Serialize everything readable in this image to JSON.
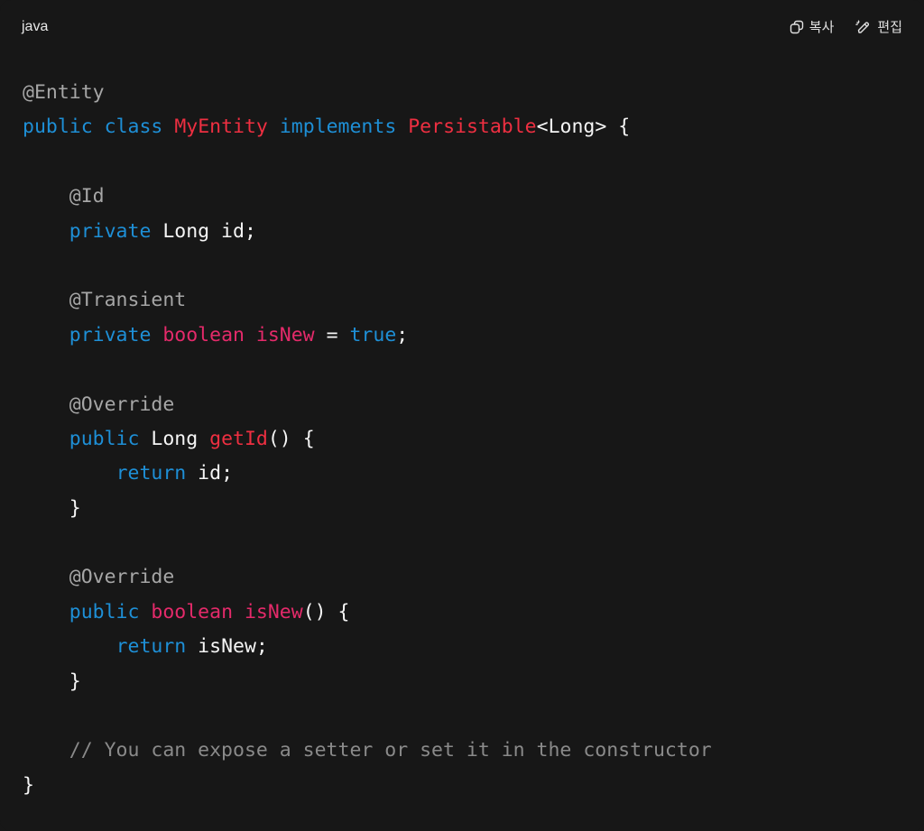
{
  "header": {
    "language": "java",
    "copy_label": "복사",
    "edit_label": "편집",
    "copy_icon": "copy-icon",
    "edit_icon": "edit-pencil-icon"
  },
  "colors": {
    "background": "#171717",
    "keyword": "#1e8fd6",
    "type_name": "#ee2f41",
    "primitive": "#e42a6a",
    "annotation": "#a6a6a6",
    "comment": "#8a8a8a",
    "plain": "#f5f5f5"
  },
  "code": {
    "lines": [
      [
        {
          "t": "ann",
          "v": "@Entity"
        }
      ],
      [
        {
          "t": "kw",
          "v": "public"
        },
        {
          "t": "pl",
          "v": " "
        },
        {
          "t": "kw",
          "v": "class"
        },
        {
          "t": "pl",
          "v": " "
        },
        {
          "t": "typ",
          "v": "MyEntity"
        },
        {
          "t": "pl",
          "v": " "
        },
        {
          "t": "kw",
          "v": "implements"
        },
        {
          "t": "pl",
          "v": " "
        },
        {
          "t": "typ",
          "v": "Persistable"
        },
        {
          "t": "pl",
          "v": "<Long> {"
        }
      ],
      [],
      [
        {
          "t": "pl",
          "v": "    "
        },
        {
          "t": "ann",
          "v": "@Id"
        }
      ],
      [
        {
          "t": "pl",
          "v": "    "
        },
        {
          "t": "kw",
          "v": "private"
        },
        {
          "t": "pl",
          "v": " Long id;"
        }
      ],
      [],
      [
        {
          "t": "pl",
          "v": "    "
        },
        {
          "t": "ann",
          "v": "@Transient"
        }
      ],
      [
        {
          "t": "pl",
          "v": "    "
        },
        {
          "t": "kw",
          "v": "private"
        },
        {
          "t": "pl",
          "v": " "
        },
        {
          "t": "prim",
          "v": "boolean"
        },
        {
          "t": "pl",
          "v": " "
        },
        {
          "t": "prim",
          "v": "isNew"
        },
        {
          "t": "pl",
          "v": " = "
        },
        {
          "t": "kw",
          "v": "true"
        },
        {
          "t": "pl",
          "v": ";"
        }
      ],
      [],
      [
        {
          "t": "pl",
          "v": "    "
        },
        {
          "t": "ann",
          "v": "@Override"
        }
      ],
      [
        {
          "t": "pl",
          "v": "    "
        },
        {
          "t": "kw",
          "v": "public"
        },
        {
          "t": "pl",
          "v": " Long "
        },
        {
          "t": "fn",
          "v": "getId"
        },
        {
          "t": "pl",
          "v": "() {"
        }
      ],
      [
        {
          "t": "pl",
          "v": "        "
        },
        {
          "t": "kw",
          "v": "return"
        },
        {
          "t": "pl",
          "v": " id;"
        }
      ],
      [
        {
          "t": "pl",
          "v": "    }"
        }
      ],
      [],
      [
        {
          "t": "pl",
          "v": "    "
        },
        {
          "t": "ann",
          "v": "@Override"
        }
      ],
      [
        {
          "t": "pl",
          "v": "    "
        },
        {
          "t": "kw",
          "v": "public"
        },
        {
          "t": "pl",
          "v": " "
        },
        {
          "t": "prim",
          "v": "boolean"
        },
        {
          "t": "pl",
          "v": " "
        },
        {
          "t": "prim",
          "v": "isNew"
        },
        {
          "t": "pl",
          "v": "() {"
        }
      ],
      [
        {
          "t": "pl",
          "v": "        "
        },
        {
          "t": "kw",
          "v": "return"
        },
        {
          "t": "pl",
          "v": " isNew;"
        }
      ],
      [
        {
          "t": "pl",
          "v": "    }"
        }
      ],
      [],
      [
        {
          "t": "pl",
          "v": "    "
        },
        {
          "t": "cmt",
          "v": "// You can expose a setter or set it in the constructor"
        }
      ],
      [
        {
          "t": "pl",
          "v": "}"
        }
      ]
    ]
  }
}
